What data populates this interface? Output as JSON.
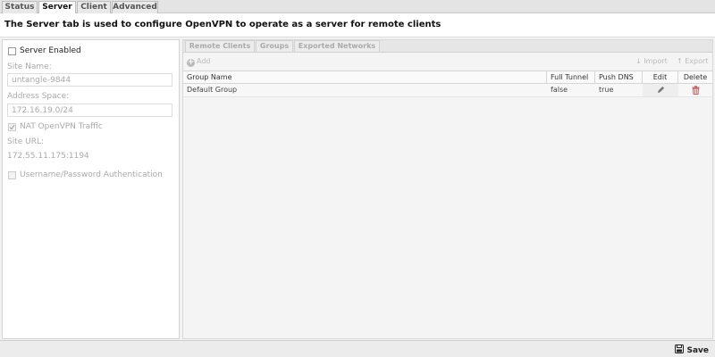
{
  "tabs": [
    {
      "label": "Status"
    },
    {
      "label": "Server"
    },
    {
      "label": "Client"
    },
    {
      "label": "Advanced"
    }
  ],
  "intro": "The Server tab is used to configure OpenVPN to operate as a server for remote clients",
  "server": {
    "enabled_label": "Server Enabled",
    "site_name_label": "Site Name:",
    "site_name_value": "untangle-9844",
    "address_space_label": "Address Space:",
    "address_space_value": "172.16.19.0/24",
    "nat_label": "NAT OpenVPN Traffic",
    "site_url_label": "Site URL:",
    "site_url_value": "172.55.11.175:1194",
    "auth_label": "Username/Password Authentication"
  },
  "subtabs": [
    "Remote Clients",
    "Groups",
    "Exported Networks"
  ],
  "toolbar": {
    "add": "Add",
    "import": "Import",
    "export": "Export"
  },
  "grid": {
    "columns": [
      "Group Name",
      "Full Tunnel",
      "Push DNS",
      "Edit",
      "Delete"
    ],
    "rows": [
      {
        "group_name": "Default Group",
        "full_tunnel": "false",
        "push_dns": "true"
      }
    ]
  },
  "footer": {
    "save": "Save"
  },
  "colors": {
    "delete_icon": "#e05050"
  }
}
